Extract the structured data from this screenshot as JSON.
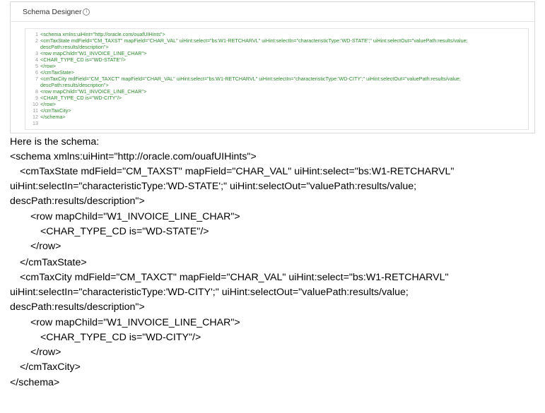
{
  "designer": {
    "title": "Schema Designer",
    "info_icon": "i",
    "code_lines": [
      {
        "n": "1",
        "text": "<schema xmlns:uiHint=\"http://oracle.com/ouafUIHints\">"
      },
      {
        "n": "2",
        "text": "   <cmTaxState mdField=\"CM_TAXST\" mapField=\"CHAR_VAL\" uiHint:select=\"bs:W1-RETCHARVL\" uiHint:selectIn=\"characteristicType:'WD-STATE';\" uiHint:selectOut=\"valuePath:results/value;"
      },
      {
        "n": "",
        "text": "   descPath:results/description\">"
      },
      {
        "n": "3",
        "text": "       <row mapChild=\"W1_INVOICE_LINE_CHAR\">"
      },
      {
        "n": "4",
        "text": "          <CHAR_TYPE_CD is=\"WD-STATE\"/>"
      },
      {
        "n": "5",
        "text": "       </row>"
      },
      {
        "n": "6",
        "text": "   </cmTaxState>"
      },
      {
        "n": "7",
        "text": "   <cmTaxCity mdField=\"CM_TAXCT\" mapField=\"CHAR_VAL\" uiHint:select=\"bs:W1-RETCHARVL\" uiHint:selectIn=\"characteristicType:'WD-CITY';\" uiHint:selectOut=\"valuePath:results/value;"
      },
      {
        "n": "",
        "text": "   descPath:results/description\">"
      },
      {
        "n": "8",
        "text": "       <row mapChild=\"W1_INVOICE_LINE_CHAR\">"
      },
      {
        "n": "9",
        "text": "          <CHAR_TYPE_CD is=\"WD-CITY\"/>"
      },
      {
        "n": "10",
        "text": "       </row>"
      },
      {
        "n": "11",
        "text": "   </cmTaxCity>"
      },
      {
        "n": "12",
        "text": "</schema>"
      },
      {
        "n": "13",
        "text": ""
      }
    ]
  },
  "document": {
    "lines": [
      "Here is the schema:",
      "<schema xmlns:uiHint=\"http://oracle.com/ouafUIHints\">",
      "<cmTaxState mdField=\"CM_TAXST\" mapField=\"CHAR_VAL\" uiHint:select=\"bs:W1-RETCHARVL\"",
      "uiHint:selectIn=\"characteristicType:'WD-STATE';\" uiHint:selectOut=\"valuePath:results/value;",
      "descPath:results/description\">",
      "<row mapChild=\"W1_INVOICE_LINE_CHAR\">",
      "<CHAR_TYPE_CD is=\"WD-STATE\"/>",
      "</row>",
      "</cmTaxState>",
      "<cmTaxCity mdField=\"CM_TAXCT\" mapField=\"CHAR_VAL\" uiHint:select=\"bs:W1-RETCHARVL\"",
      "uiHint:selectIn=\"characteristicType:'WD-CITY';\" uiHint:selectOut=\"valuePath:results/value;",
      "descPath:results/description\">",
      "<row mapChild=\"W1_INVOICE_LINE_CHAR\">",
      "<CHAR_TYPE_CD is=\"WD-CITY\"/>",
      "</row>",
      "</cmTaxCity>",
      "</schema>"
    ]
  }
}
